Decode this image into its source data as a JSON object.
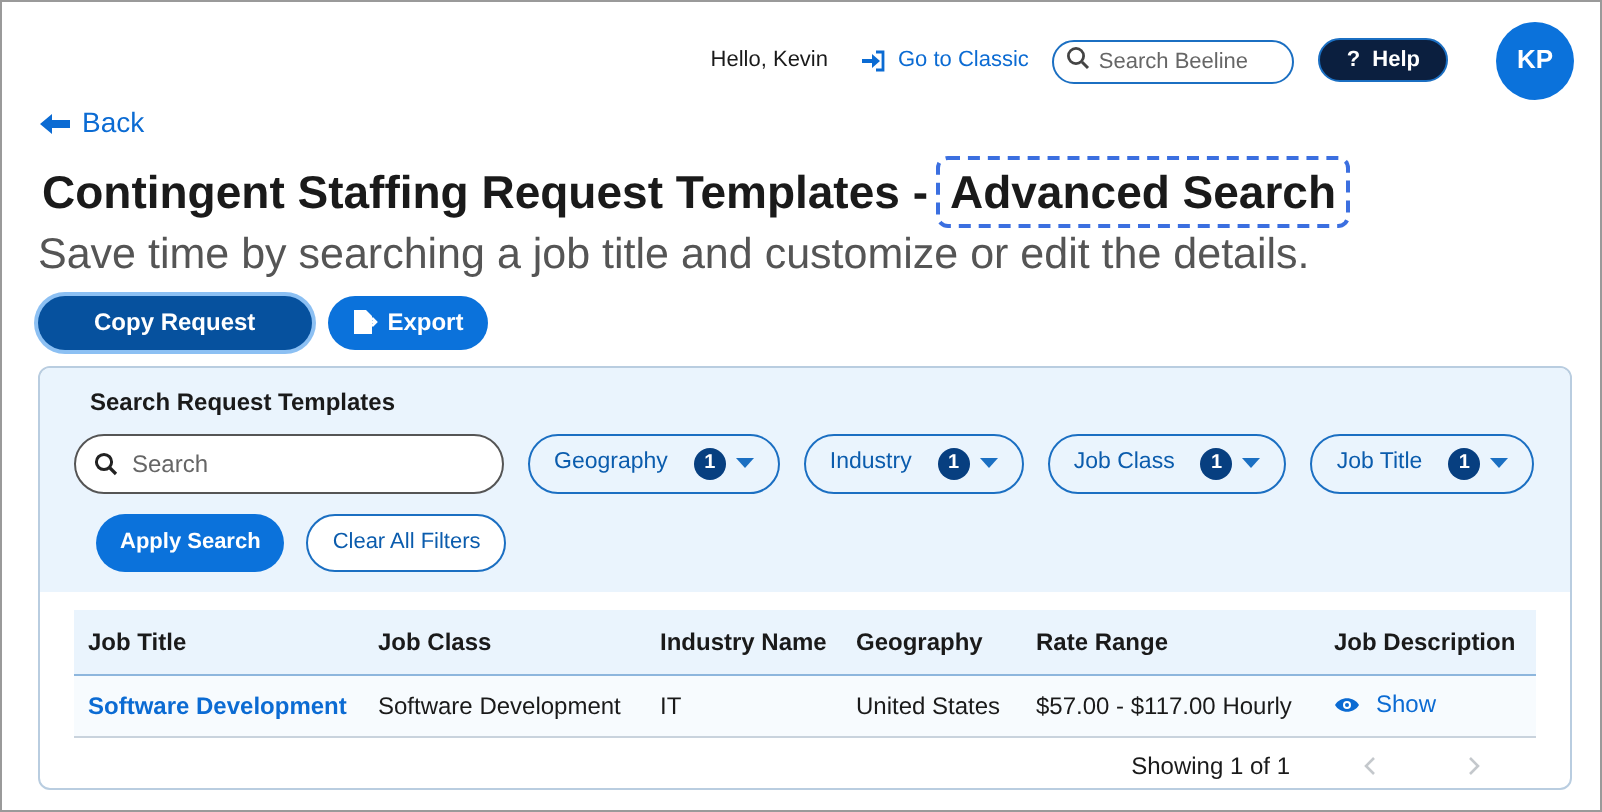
{
  "header": {
    "greeting": "Hello, Kevin",
    "classic_link": "Go to Classic",
    "search": {
      "placeholder": "Search Beeline"
    },
    "help": {
      "icon": "?",
      "label": "Help"
    },
    "avatar": "KP"
  },
  "back": "Back",
  "title": [
    {
      "text": "Contingent Staffing Request Templates -",
      "focused": false
    },
    {
      "text": "Advanced Search",
      "focused": true
    }
  ],
  "subtitle": "Save time by searching a job title and customize or edit the details.",
  "actions": [
    {
      "label": "Copy Request",
      "kind": "plain",
      "focused": true
    },
    {
      "label": "Export",
      "kind": "export",
      "focused": false
    }
  ],
  "search_panel": {
    "heading": "Search Request Templates",
    "search": {
      "placeholder": "Search"
    },
    "filters": [
      {
        "label": "Geography",
        "count": "1"
      },
      {
        "label": "Industry",
        "count": "1"
      },
      {
        "label": "Job Class",
        "count": "1"
      },
      {
        "label": "Job Title",
        "count": "1"
      }
    ],
    "buttons": [
      {
        "label": "Apply Search",
        "kind": "primary"
      },
      {
        "label": "Clear All Filters",
        "kind": "outline"
      }
    ]
  },
  "table": {
    "columns": [
      "Job Title",
      "Job Class",
      "Industry Name",
      "Geography",
      "Rate Range",
      "Job Description"
    ],
    "rows": [
      {
        "job_title": "Software Development",
        "job_class": "Software Development",
        "industry_name": "IT",
        "geography": "United States",
        "rate_range": "$57.00 - $117.00 Hourly",
        "job_description": "Show"
      }
    ]
  },
  "pagination": {
    "summary": "Showing 1 of 1",
    "previous": {
      "disabled": true
    },
    "next": {
      "disabled": true
    }
  }
}
